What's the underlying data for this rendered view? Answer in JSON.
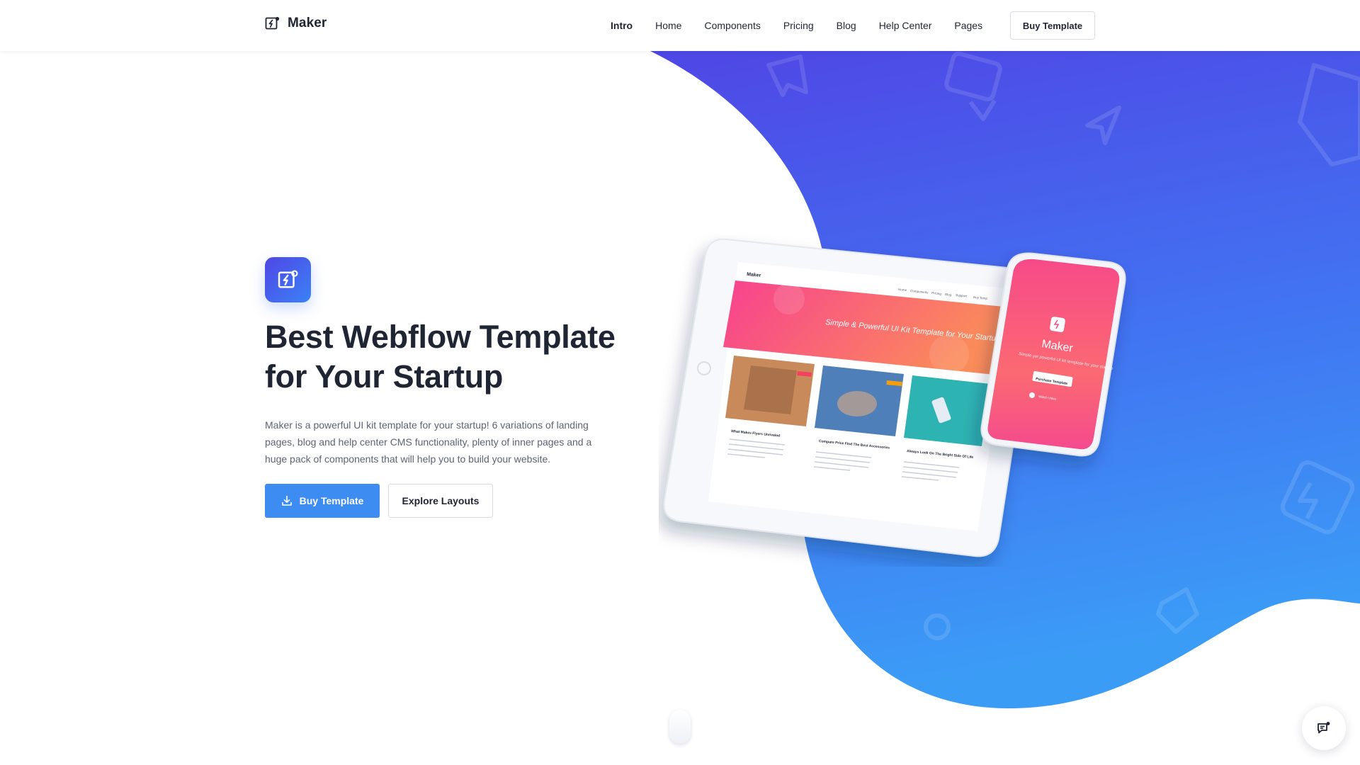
{
  "brand": {
    "name": "Maker"
  },
  "nav": {
    "links": [
      "Intro",
      "Home",
      "Components",
      "Pricing",
      "Blog",
      "Help Center",
      "Pages"
    ],
    "active": "Intro",
    "cta_label": "Buy Template"
  },
  "hero": {
    "title": "Best Webflow Template for Your Startup",
    "description": "Maker is a powerful UI kit template for your startup! 6 variations of landing pages, blog and help center CMS functionality, plenty of inner pages and a huge pack of components that will help you to build your website.",
    "primary_button": "Buy Template",
    "secondary_button": "Explore Layouts"
  },
  "mockup": {
    "tablet": {
      "brand": "Maker",
      "nav": [
        "Intro",
        "Home",
        "Components",
        "Pricing",
        "Blog",
        "Support",
        "Buy Temp"
      ],
      "hero_text": "Simple & Powerful UI Kit Template for Your Startup",
      "cards": [
        {
          "title": "What Makes Flyers Unrivaled",
          "badge_color": "#f43f5e"
        },
        {
          "title": "Compare Price Find The Best Accessories",
          "badge_color": "#f59e0b"
        },
        {
          "title": "Always Look On The Bright Side Of Life",
          "badge_color": "#22c55e"
        }
      ]
    },
    "phone": {
      "brand": "Maker",
      "tagline": "Simple yet powerful UI kit template for your startup",
      "button": "Purchase Template",
      "link": "Watch Video"
    }
  },
  "colors": {
    "primary": "#3d8cf1",
    "gradient_top": "#4f46e5",
    "gradient_bottom": "#3b9cf6",
    "text_dark": "#1f2532",
    "text_muted": "#5c6372"
  },
  "icons": {
    "brand": "maker-logo-icon",
    "download": "download-icon",
    "chat": "chat-icon",
    "scroll": "scroll-mouse-icon"
  }
}
